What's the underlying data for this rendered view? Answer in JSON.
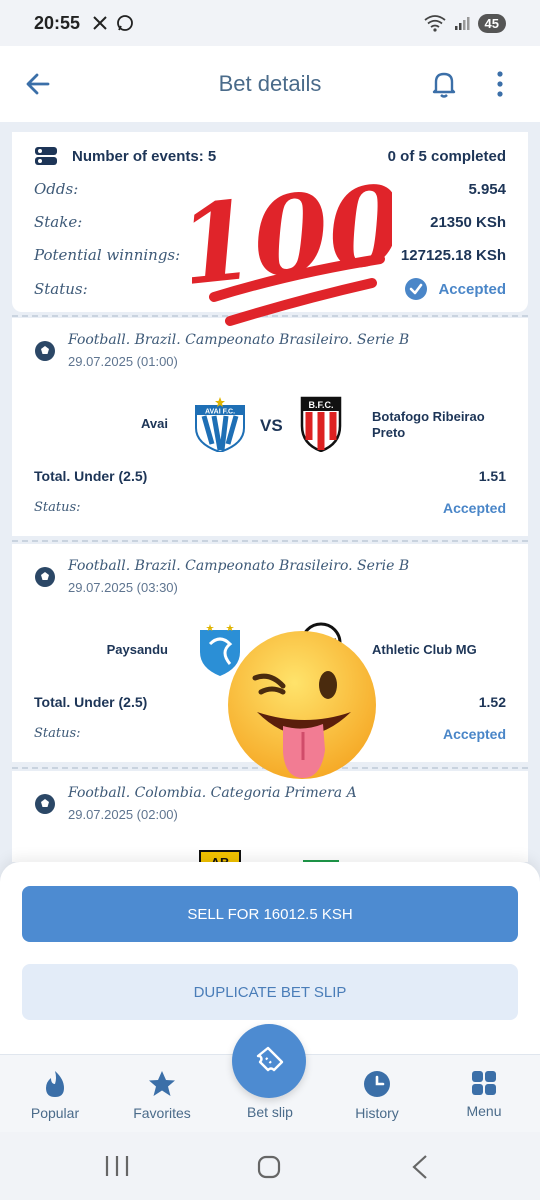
{
  "status_bar": {
    "time": "20:55",
    "battery": "45",
    "icons": [
      "x-icon",
      "whatsapp-icon",
      "wifi-icon",
      "signal-icon"
    ]
  },
  "header": {
    "title": "Bet details",
    "icons": [
      "back-arrow-icon",
      "bell-icon",
      "more-vertical-icon"
    ]
  },
  "summary": {
    "events_label": "Number of events: 5",
    "completed": "0 of 5 completed",
    "odds_label": "Odds:",
    "odds_value": "5.954",
    "stake_label": "Stake:",
    "stake_value": "21350 KSh",
    "winnings_label": "Potential winnings:",
    "winnings_value": "127125.18 KSh",
    "status_label": "Status:",
    "status_value": "Accepted"
  },
  "events": [
    {
      "league": "Football. Brazil. Campeonato Brasileiro. Serie B",
      "date": "29.07.2025 (01:00)",
      "home": "Avai",
      "vs": "VS",
      "away": "Botafogo Ribeirao Preto",
      "market": "Total. Under (2.5)",
      "odds": "1.51",
      "status_label": "Status:",
      "status_value": "Accepted"
    },
    {
      "league": "Football. Brazil. Campeonato Brasileiro. Serie B",
      "date": "29.07.2025 (03:30)",
      "home": "Paysandu",
      "away": "Athletic Club MG",
      "market": "Total. Under (2.5)",
      "odds": "1.52",
      "status_label": "Status:",
      "status_value": "Accepted"
    },
    {
      "league": "Football. Colombia. Categoria Primera A",
      "date": "29.07.2025 (02:00)"
    }
  ],
  "logos": {
    "avai": "AVAI F.C.",
    "botafogo": "B.F.C.",
    "alianza": "AB"
  },
  "stickers": {
    "hundred": "100",
    "emoji": "winking-face-with-tongue"
  },
  "actions": {
    "sell": "SELL FOR 16012.5 KSH",
    "duplicate": "DUPLICATE BET SLIP"
  },
  "nav": {
    "popular": "Popular",
    "favorites": "Favorites",
    "bet_slip": "Bet slip",
    "history": "History",
    "menu": "Menu"
  },
  "colors": {
    "accent": "#4d8bd1",
    "accepted": "#4a86c8",
    "title": "#4a6b8a",
    "text_dark": "#1d3557",
    "background": "#e9eef5",
    "sticker_red": "#e0242a"
  }
}
